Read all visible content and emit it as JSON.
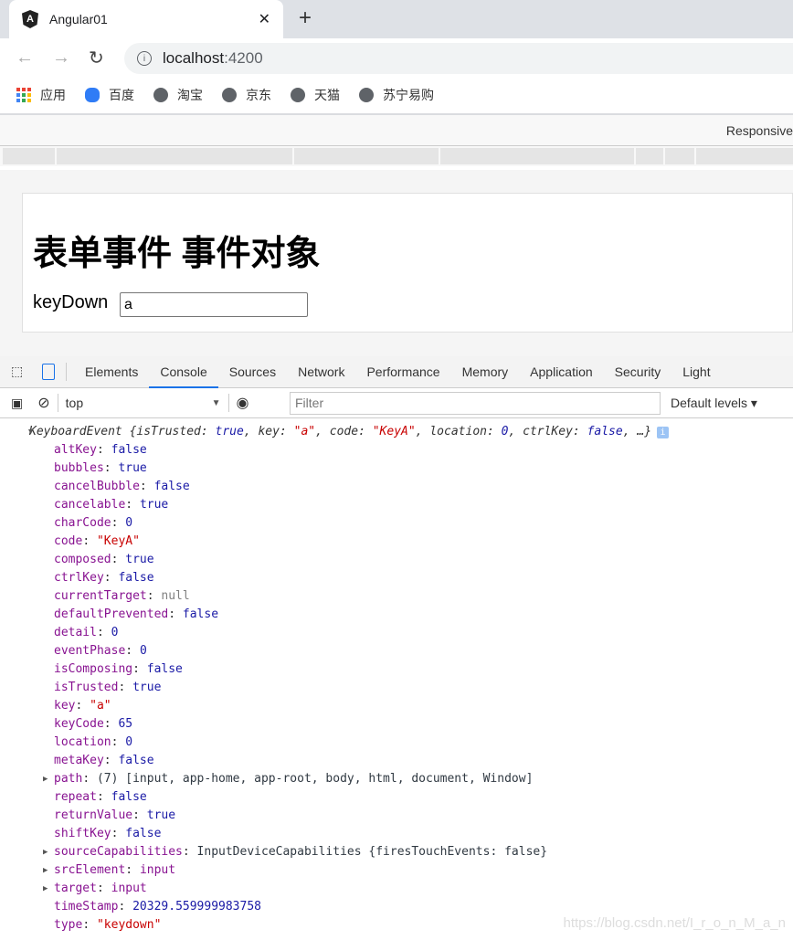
{
  "browser": {
    "tab_title": "Angular01",
    "url_host": "localhost",
    "url_port": ":4200",
    "bookmarks": [
      "应用",
      "百度",
      "淘宝",
      "京东",
      "天猫",
      "苏宁易购"
    ]
  },
  "device_toolbar": {
    "mode": "Responsive"
  },
  "page": {
    "title": "表单事件 事件对象",
    "label": "keyDown",
    "input_value": "a"
  },
  "devtools": {
    "tabs": [
      "Elements",
      "Console",
      "Sources",
      "Network",
      "Performance",
      "Memory",
      "Application",
      "Security",
      "Light"
    ],
    "active_tab": "Console",
    "context": "top",
    "filter_placeholder": "Filter",
    "levels": "Default levels"
  },
  "console": {
    "summary": {
      "name": "KeyboardEvent",
      "parts": [
        [
          "isTrusted",
          "true",
          "b"
        ],
        [
          "key",
          "\"a\"",
          "s"
        ],
        [
          "code",
          "\"KeyA\"",
          "s"
        ],
        [
          "location",
          "0",
          "b"
        ],
        [
          "ctrlKey",
          "false",
          "b"
        ]
      ],
      "more": "…}"
    },
    "props": [
      [
        "altKey",
        "false",
        "b",
        false
      ],
      [
        "bubbles",
        "true",
        "b",
        false
      ],
      [
        "cancelBubble",
        "false",
        "b",
        false
      ],
      [
        "cancelable",
        "true",
        "b",
        false
      ],
      [
        "charCode",
        "0",
        "b",
        false
      ],
      [
        "code",
        "\"KeyA\"",
        "s",
        false
      ],
      [
        "composed",
        "true",
        "b",
        false
      ],
      [
        "ctrlKey",
        "false",
        "b",
        false
      ],
      [
        "currentTarget",
        "null",
        "n",
        false
      ],
      [
        "defaultPrevented",
        "false",
        "b",
        false
      ],
      [
        "detail",
        "0",
        "b",
        false
      ],
      [
        "eventPhase",
        "0",
        "b",
        false
      ],
      [
        "isComposing",
        "false",
        "b",
        false
      ],
      [
        "isTrusted",
        "true",
        "b",
        false
      ],
      [
        "key",
        "\"a\"",
        "s",
        false
      ],
      [
        "keyCode",
        "65",
        "b",
        false
      ],
      [
        "location",
        "0",
        "b",
        false
      ],
      [
        "metaKey",
        "false",
        "b",
        false
      ],
      [
        "path",
        "(7) [input, app-home, app-root, body, html, document, Window]",
        "o",
        true
      ],
      [
        "repeat",
        "false",
        "b",
        false
      ],
      [
        "returnValue",
        "true",
        "b",
        false
      ],
      [
        "shiftKey",
        "false",
        "b",
        false
      ],
      [
        "sourceCapabilities",
        "InputDeviceCapabilities {firesTouchEvents: false}",
        "o",
        true
      ],
      [
        "srcElement",
        "input",
        "k",
        true
      ],
      [
        "target",
        "input",
        "k",
        true
      ],
      [
        "timeStamp",
        "20329.559999983758",
        "b",
        false
      ],
      [
        "type",
        "\"keydown\"",
        "s",
        false
      ]
    ]
  },
  "watermark": "https://blog.csdn.net/I_r_o_n_M_a_n",
  "colors": {
    "accent": "#1a73e8",
    "key": "#881391",
    "bool": "#1a1aa6",
    "string": "#c80000"
  }
}
